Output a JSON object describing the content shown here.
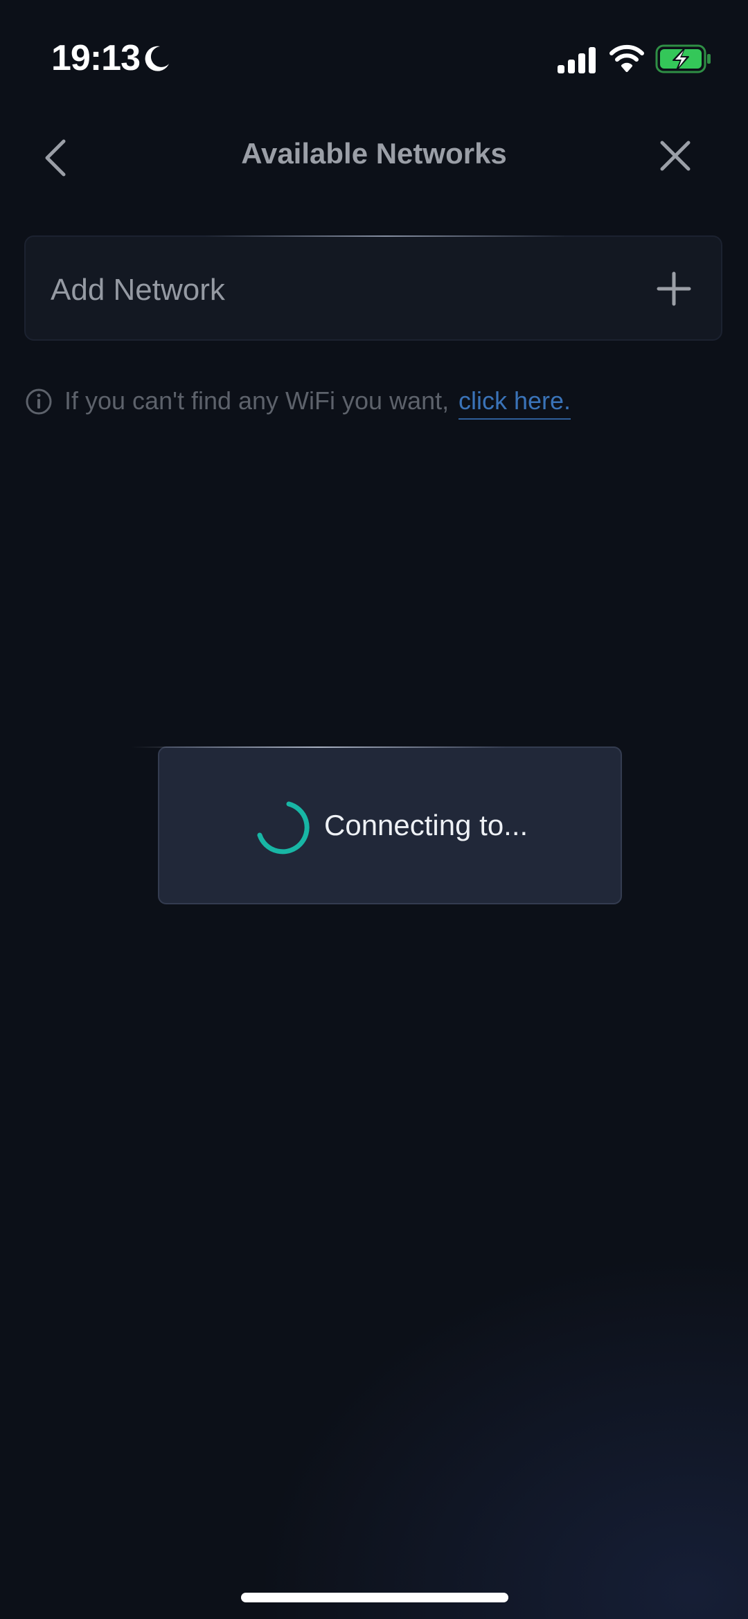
{
  "status_bar": {
    "time": "19:13",
    "icons": [
      "moon-icon",
      "signal-icon",
      "wifi-icon",
      "battery-charging-icon"
    ]
  },
  "header": {
    "title": "Available Networks",
    "back_icon": "chevron-left-icon",
    "close_icon": "close-icon"
  },
  "add_network": {
    "label": "Add Network",
    "icon": "plus-icon"
  },
  "info": {
    "text": "If you can't find any WiFi you want,",
    "link_text": "click here.",
    "icon": "info-icon"
  },
  "dialog": {
    "message": "Connecting to...",
    "icon": "spinner-icon"
  },
  "colors": {
    "background": "#0c1018",
    "card": "#131822",
    "dialog": "#212839",
    "link": "#3a73b8",
    "spinner": "#18b6a5",
    "battery": "#34c759"
  }
}
